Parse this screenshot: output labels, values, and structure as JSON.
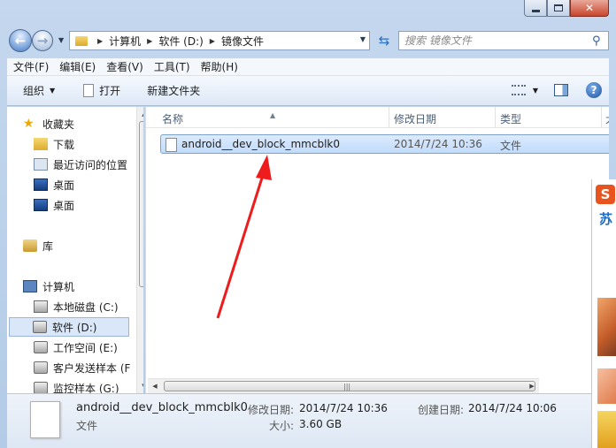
{
  "navigation": {
    "breadcrumb": [
      "计算机",
      "软件 (D:)",
      "镜像文件"
    ],
    "search_placeholder": "搜索 镜像文件"
  },
  "menu": [
    "文件(F)",
    "编辑(E)",
    "查看(V)",
    "工具(T)",
    "帮助(H)"
  ],
  "toolbar": {
    "organize": "组织",
    "open": "打开",
    "new_folder": "新建文件夹"
  },
  "sidebar": {
    "items": [
      {
        "label": "收藏夹",
        "icon": "star-icon"
      },
      {
        "label": "下载",
        "icon": "downloads-folder-icon"
      },
      {
        "label": "最近访问的位置",
        "icon": "recent-places-icon"
      },
      {
        "label": "桌面",
        "icon": "desktop-icon"
      },
      {
        "label": "桌面",
        "icon": "desktop-icon"
      },
      {
        "label": "库",
        "icon": "library-icon"
      },
      {
        "label": "计算机",
        "icon": "computer-icon"
      },
      {
        "label": "本地磁盘 (C:)",
        "icon": "system-drive-icon"
      },
      {
        "label": "软件 (D:)",
        "icon": "drive-icon",
        "selected": true
      },
      {
        "label": "工作空间 (E:)",
        "icon": "drive-icon"
      },
      {
        "label": "客户发送样本 (F",
        "icon": "drive-icon"
      },
      {
        "label": "监控样本 (G:)",
        "icon": "drive-icon"
      }
    ]
  },
  "columns": {
    "name": "名称",
    "modified": "修改日期",
    "type": "类型",
    "size": "大"
  },
  "files": [
    {
      "name": "android__dev_block_mmcblk0",
      "modified": "2014/7/24 10:36",
      "type": "文件"
    }
  ],
  "details": {
    "name": "android__dev_block_mmcblk0",
    "type": "文件",
    "modified_label": "修改日期:",
    "modified_value": "2014/7/24 10:36",
    "created_label": "创建日期:",
    "created_value": "2014/7/24 10:06",
    "size_label": "大小:",
    "size_value": "3.60 GB"
  },
  "side_app": {
    "logo_char": "S",
    "text": "苏"
  },
  "annotation_color": "#ee1c1c",
  "icons": {
    "back": "back-arrow-icon",
    "forward": "forward-arrow-icon",
    "refresh": "refresh-icon",
    "search": "search-icon",
    "help": "help-icon"
  }
}
